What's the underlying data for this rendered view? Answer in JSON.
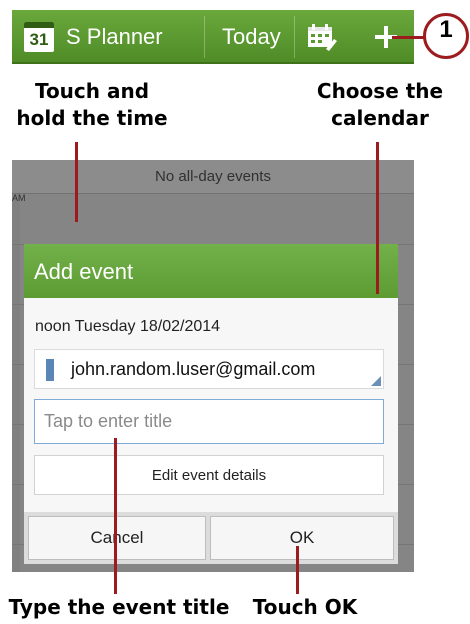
{
  "action_bar": {
    "calendar_icon_day": "31",
    "app_title": "S Planner",
    "today_label": "Today",
    "colors": {
      "background": "#5a9a30",
      "text": "#ffffff"
    }
  },
  "callouts": {
    "step_number": "1",
    "line_color": "#9c1b1f"
  },
  "annotations": {
    "touch_hold": [
      "Touch and",
      "hold the time"
    ],
    "choose_calendar": [
      "Choose the",
      "calendar"
    ],
    "type_title": "Type the event title",
    "touch_ok": "Touch OK"
  },
  "planner": {
    "all_day": "No all-day events",
    "time_marker": "AM"
  },
  "dialog": {
    "title": "Add event",
    "datetime": "noon Tuesday 18/02/2014",
    "calendar_account": "john.random.luser@gmail.com",
    "title_placeholder": "Tap to enter title",
    "edit_details": "Edit event details",
    "cancel": "Cancel",
    "ok": "OK",
    "colors": {
      "header": "#66a63c",
      "calendar_swatch": "#5a85b5"
    }
  }
}
